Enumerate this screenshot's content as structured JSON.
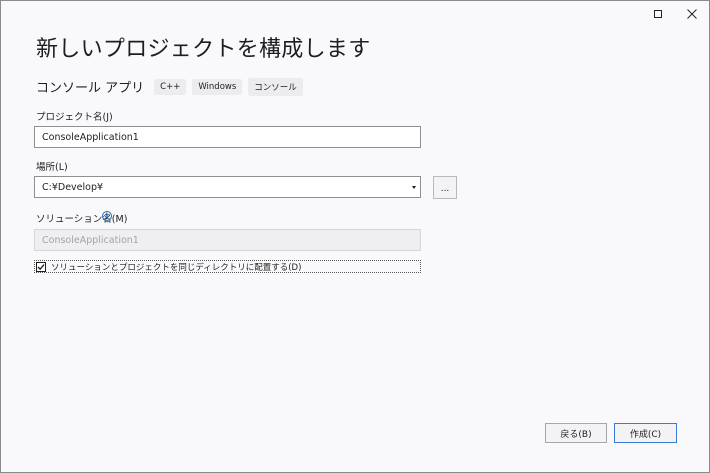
{
  "window": {
    "title": "新しいプロジェクトを構成します",
    "subtitle": "コンソール アプリ",
    "tags": [
      "C++",
      "Windows",
      "コンソール"
    ]
  },
  "form": {
    "project_name_label": "プロジェクト名(J)",
    "project_name_value": "ConsoleApplication1",
    "location_label": "場所(L)",
    "location_value": "C:¥Develop¥",
    "browse_label": "...",
    "solution_name_label": "ソリューション名(M)",
    "solution_name_value": "ConsoleApplication1",
    "same_dir_checkbox_label": "ソリューションとプロジェクトを同じディレクトリに配置する(D)",
    "same_dir_checked": true
  },
  "footer": {
    "back_label": "戻る(B)",
    "create_label": "作成(C)"
  },
  "colors": {
    "background": "#f9f9fb",
    "accent": "#3a7bd5",
    "info": "#1a6fc4"
  }
}
